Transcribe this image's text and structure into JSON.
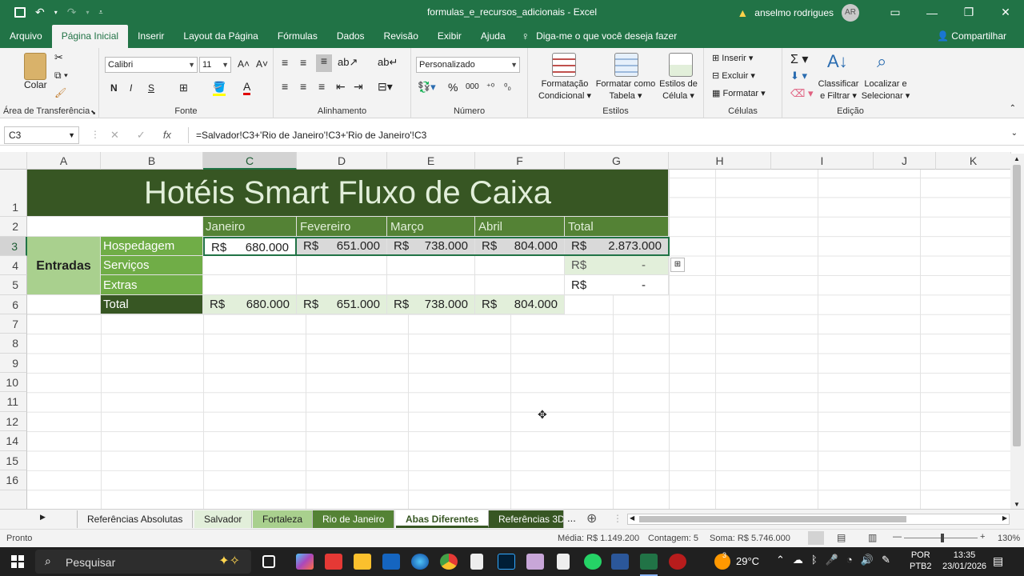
{
  "titlebar": {
    "filename": "formulas_e_recursos_adicionais",
    "separator": " - ",
    "app": "Excel",
    "user": "anselmo rodrigues",
    "initials": "AR",
    "icons": [
      "save-icon",
      "undo-icon",
      "redo-icon",
      "customize-icon",
      "warning-icon",
      "ribbon-display-icon",
      "minimize-icon",
      "maximize-icon",
      "close-icon"
    ]
  },
  "menu": {
    "tabs": [
      "Arquivo",
      "Página Inicial",
      "Inserir",
      "Layout da Página",
      "Fórmulas",
      "Dados",
      "Revisão",
      "Exibir",
      "Ajuda"
    ],
    "active": "Página Inicial",
    "tellme": "Diga-me o que você deseja fazer",
    "share": "Compartilhar"
  },
  "ribbon": {
    "clipboard": {
      "paste": "Colar",
      "label": "Área de Transferência"
    },
    "font": {
      "name": "Calibri",
      "size": "11",
      "bold": "N",
      "italic": "I",
      "underline": "S",
      "label": "Fonte"
    },
    "alignment": {
      "label": "Alinhamento"
    },
    "number": {
      "format": "Personalizado",
      "percent": "%",
      "thousands": "000",
      "label": "Número"
    },
    "styles": {
      "cond_format_1": "Formatação",
      "cond_format_2": "Condicional",
      "table_1": "Formatar como",
      "table_2": "Tabela",
      "cell_styles_1": "Estilos de",
      "cell_styles_2": "Célula",
      "label": "Estilos"
    },
    "cells": {
      "insert": "Inserir",
      "delete": "Excluir",
      "format": "Formatar",
      "label": "Células"
    },
    "editing": {
      "sort_1": "Classificar",
      "sort_2": "e Filtrar",
      "find_1": "Localizar e",
      "find_2": "Selecionar",
      "label": "Edição"
    }
  },
  "formula_bar": {
    "name_box": "C3",
    "fx": "fx",
    "formula": "=Salvador!C3+'Rio de Janeiro'!C3+'Rio de Janeiro'!C3"
  },
  "columns": [
    "A",
    "B",
    "C",
    "D",
    "E",
    "F",
    "G",
    "H",
    "I",
    "J",
    "K"
  ],
  "selected_column": "C",
  "rows": [
    "1",
    "2",
    "3",
    "4",
    "5",
    "6",
    "7",
    "8",
    "9",
    "10",
    "11",
    "12",
    "14",
    "15",
    "16"
  ],
  "selected_row": "3",
  "sheet": {
    "title": "Hotéis Smart Fluxo de Caixa",
    "months": [
      "Janeiro",
      "Fevereiro",
      "Março",
      "Abril",
      "Total"
    ],
    "section": "Entradas",
    "row_labels": [
      "Hospedagem",
      "Serviços",
      "Extras",
      "Total"
    ],
    "currency": "R$",
    "hospedagem": [
      "680.000",
      "651.000",
      "738.000",
      "804.000",
      "2.873.000"
    ],
    "servicos_total": "-",
    "extras_total": "-",
    "totals": [
      "680.000",
      "651.000",
      "738.000",
      "804.000"
    ]
  },
  "colors": {
    "excel_green": "#217346",
    "title_fill": "#375623",
    "header_fill": "#548235",
    "label_fill": "#70ad47",
    "light_fill": "#e2efda"
  },
  "sheet_tabs": {
    "tabs": [
      "Referências Absolutas",
      "Salvador",
      "Fortaleza",
      "Rio de Janeiro",
      "Abas Diferentes",
      "Referências 3D"
    ],
    "active": "Abas Diferentes",
    "more": "..."
  },
  "status": {
    "ready": "Pronto",
    "average": "Média:  R$ 1.149.200",
    "count": "Contagem: 5",
    "sum": "Soma:  R$ 5.746.000",
    "zoom": "130%"
  },
  "taskbar": {
    "search": "Pesquisar",
    "weather": "29°C",
    "weather_badge": "3",
    "lang": "POR",
    "layout": "PTB2",
    "time": "13:35",
    "date": "23/01/2026"
  }
}
